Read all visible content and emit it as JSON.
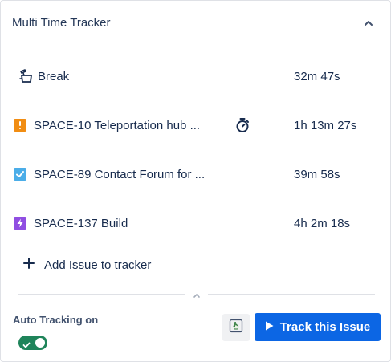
{
  "header": {
    "title": "Multi Time Tracker",
    "collapse_icon": "chevron-up-icon"
  },
  "trackers": [
    {
      "icon": "break-icon",
      "label": "Break",
      "time": "32m 47s",
      "running": false
    },
    {
      "icon": "issue-bug-icon",
      "label": "SPACE-10 Teleportation hub ...",
      "time": "1h 13m 27s",
      "running": true,
      "icon_color": "#f18d13"
    },
    {
      "icon": "issue-task-icon",
      "label": "SPACE-89 Contact Forum for ...",
      "time": "39m 58s",
      "running": false,
      "icon_color": "#4bade8"
    },
    {
      "icon": "issue-epic-icon",
      "label": "SPACE-137 Build",
      "time": "4h 2m 18s",
      "running": false,
      "icon_color": "#904ee2"
    }
  ],
  "add_issue": {
    "label": "Add Issue to tracker",
    "icon": "plus-icon"
  },
  "footer": {
    "auto_tracking_label": "Auto Tracking on",
    "auto_tracking_enabled": true,
    "track_button_label": "Track this Issue",
    "track_button_icon": "play-icon",
    "secondary_button_icon": "hand-pointer-icon"
  },
  "colors": {
    "primary": "#0c66e4",
    "toggle_on": "#1f845a",
    "text": "#172b4d",
    "border": "#dfe1e6"
  }
}
